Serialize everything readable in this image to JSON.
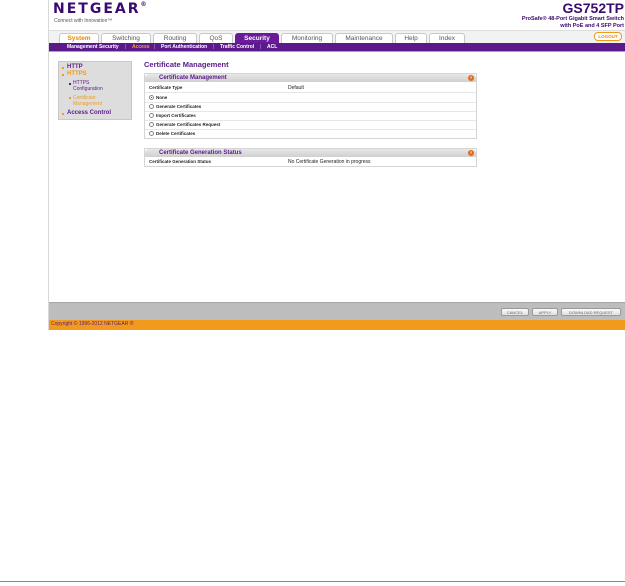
{
  "header": {
    "logo": "NETGEAR",
    "logo_mark": "®",
    "tagline": "Connect with Innovation™",
    "model": "GS752TP",
    "model_desc_line1": "ProSafe® 48-Port Gigabit Smart Switch",
    "model_desc_line2": "with PoE and 4 SFP Port"
  },
  "tabs": [
    {
      "label": "System"
    },
    {
      "label": "Switching"
    },
    {
      "label": "Routing"
    },
    {
      "label": "QoS"
    },
    {
      "label": "Security"
    },
    {
      "label": "Monitoring"
    },
    {
      "label": "Maintenance"
    },
    {
      "label": "Help"
    },
    {
      "label": "Index"
    }
  ],
  "logout_label": "LOGOUT",
  "subnav": [
    "Management Security",
    "Access",
    "Port Authentication",
    "Traffic Control",
    "ACL"
  ],
  "subnav_sep": "|",
  "sidebar": {
    "http": "HTTP",
    "https": "HTTPS",
    "https_config_1": "HTTPS",
    "https_config_2": "Configuration",
    "cert_mgmt_1": "Certificate",
    "cert_mgmt_2": "Management",
    "access_control": "Access Control"
  },
  "main": {
    "page_title": "Certificate Management",
    "panel1_title": "Certificate Management",
    "cert_type_label": "Certificate Type",
    "cert_type_value": "Default",
    "options": [
      {
        "label": "None",
        "checked": true
      },
      {
        "label": "Generate Certificates",
        "checked": false
      },
      {
        "label": "Import Certificates",
        "checked": false
      },
      {
        "label": "Generate Certificates Request",
        "checked": false
      },
      {
        "label": "Delete Certificates",
        "checked": false
      }
    ],
    "panel2_title": "Certificate Generation Status",
    "status_label": "Certificate Generation Status",
    "status_value": "No Certificate Generation in progress",
    "help_glyph": "?"
  },
  "buttons": {
    "cancel": "CANCEL",
    "apply": "APPLY",
    "download": "DOWNLOAD REQUEST"
  },
  "copyright": "Copyright © 1996-2012 NETGEAR ®",
  "colors": {
    "brand_purple": "#5b1a8a",
    "accent_orange": "#f29a1c"
  }
}
